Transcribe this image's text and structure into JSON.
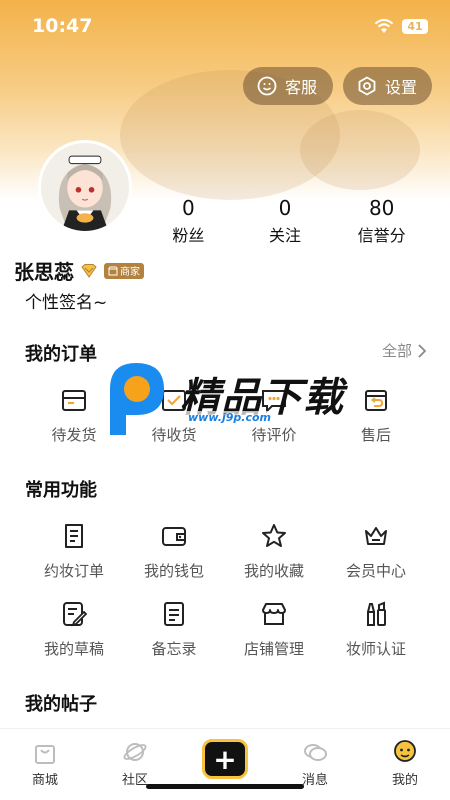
{
  "status_bar": {
    "time": "10:47",
    "battery": "41"
  },
  "header": {
    "service_label": "客服",
    "settings_label": "设置"
  },
  "profile": {
    "stats": [
      {
        "value": "0",
        "label": "粉丝"
      },
      {
        "value": "0",
        "label": "关注"
      },
      {
        "value": "80",
        "label": "信誉分"
      }
    ],
    "name": "张思蕊",
    "shop_badge": "商家",
    "signature": "个性签名~"
  },
  "orders": {
    "title": "我的订单",
    "all_label": "全部",
    "items": [
      {
        "label": "待发货",
        "icon": "box-icon"
      },
      {
        "label": "待收货",
        "icon": "truck-icon"
      },
      {
        "label": "待评价",
        "icon": "comment-icon"
      },
      {
        "label": "售后",
        "icon": "return-icon"
      }
    ]
  },
  "functions": {
    "title": "常用功能",
    "items": [
      {
        "label": "约妆订单",
        "icon": "document-icon"
      },
      {
        "label": "我的钱包",
        "icon": "wallet-icon"
      },
      {
        "label": "我的收藏",
        "icon": "star-icon"
      },
      {
        "label": "会员中心",
        "icon": "crown-icon"
      },
      {
        "label": "我的草稿",
        "icon": "draft-icon"
      },
      {
        "label": "备忘录",
        "icon": "memo-icon"
      },
      {
        "label": "店铺管理",
        "icon": "store-icon"
      },
      {
        "label": "妆师认证",
        "icon": "makeup-icon"
      }
    ]
  },
  "posts": {
    "title": "我的帖子"
  },
  "watermark": {
    "text": "精品下载",
    "url": "www.j9p.com"
  },
  "tabbar": {
    "items": [
      {
        "label": "商城",
        "icon": "bag-icon"
      },
      {
        "label": "社区",
        "icon": "planet-icon"
      },
      {
        "label": "消息",
        "icon": "chat-icon"
      },
      {
        "label": "我的",
        "icon": "face-icon"
      }
    ],
    "add_symbol": "+"
  },
  "colors": {
    "accent": "#f7c33e",
    "header_top": "#f3b24a",
    "badge": "#b3823f"
  }
}
